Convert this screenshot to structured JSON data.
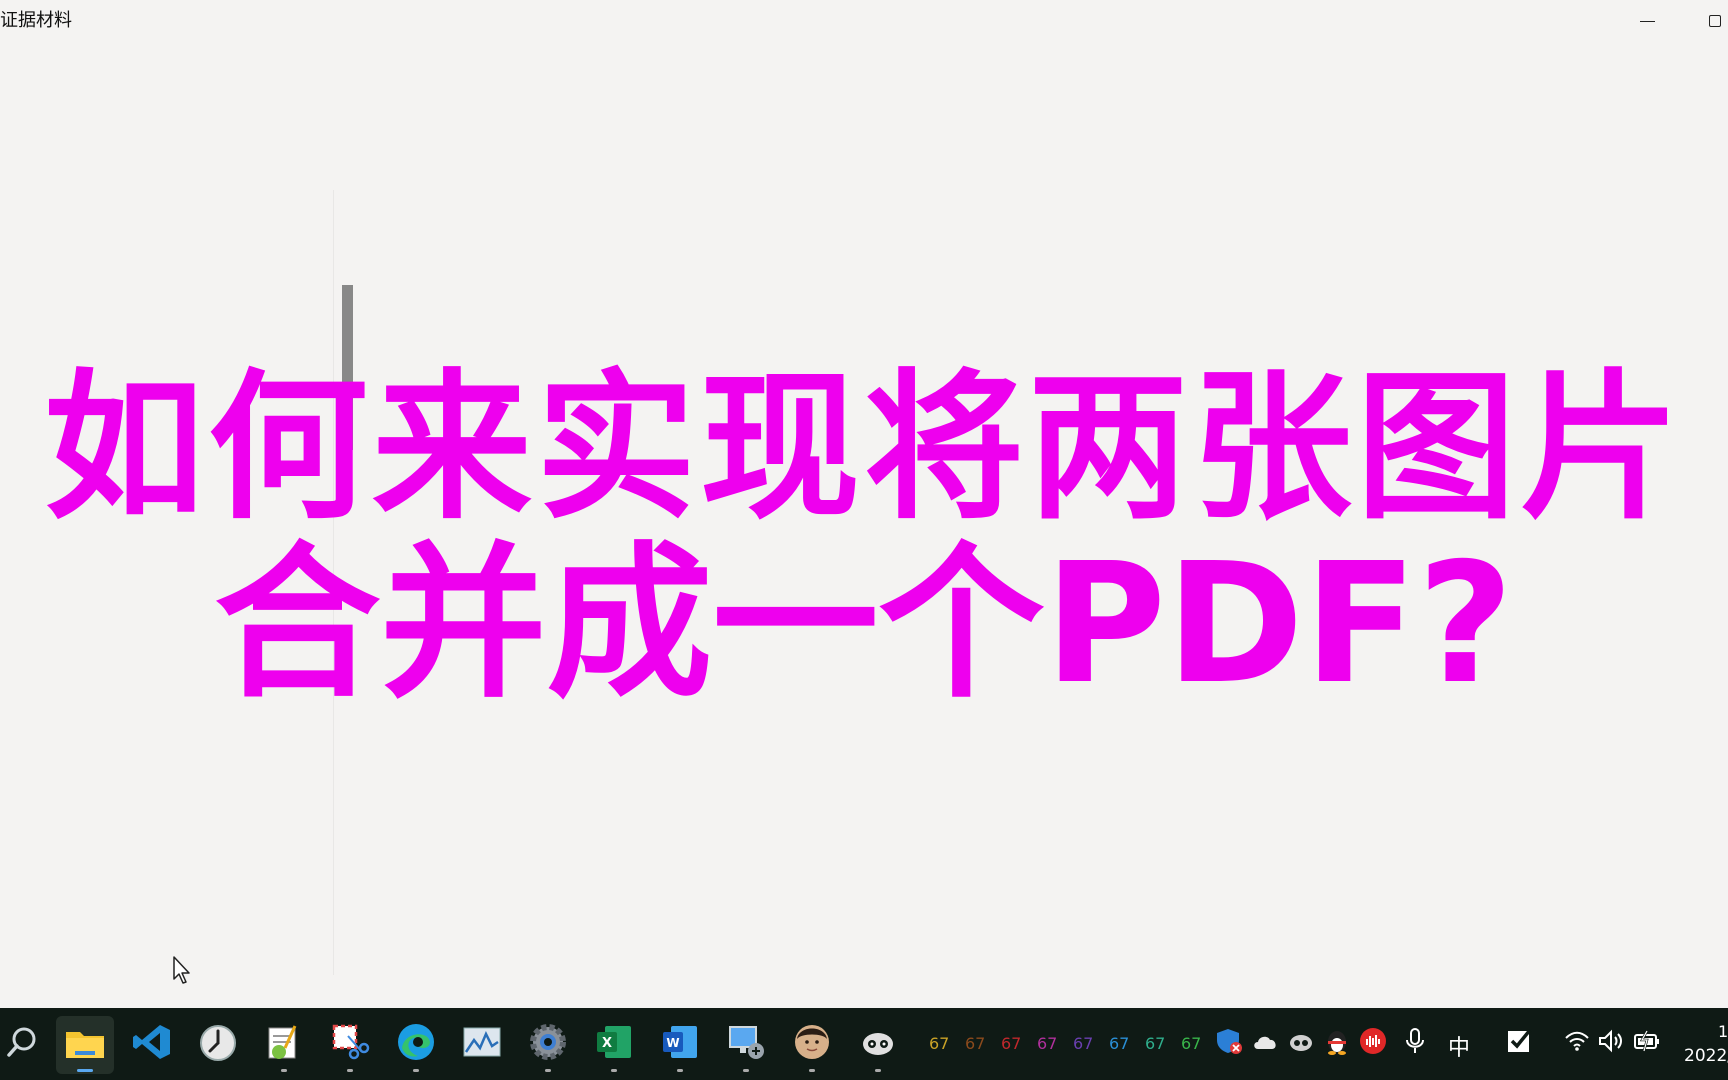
{
  "window": {
    "title": "证据材料"
  },
  "headline": {
    "line1": "如何来实现将两张图片",
    "line2": "合并成一个PDF?"
  },
  "taskbar": {
    "tray_numbers": [
      {
        "text": "67",
        "color": "#c9a227"
      },
      {
        "text": "67",
        "color": "#8b4a1c"
      },
      {
        "text": "67",
        "color": "#c0282c"
      },
      {
        "text": "67",
        "color": "#b0309c"
      },
      {
        "text": "67",
        "color": "#6a3fb0"
      },
      {
        "text": "67",
        "color": "#2a8fd6"
      },
      {
        "text": "67",
        "color": "#2fae8c"
      },
      {
        "text": "67",
        "color": "#39b54a"
      }
    ],
    "ime": "中",
    "clock_time": "1",
    "clock_date": "2022/"
  },
  "colors": {
    "headline": "#ee00ee",
    "taskbar": "#0f1a15",
    "background": "#f4f3f2"
  }
}
